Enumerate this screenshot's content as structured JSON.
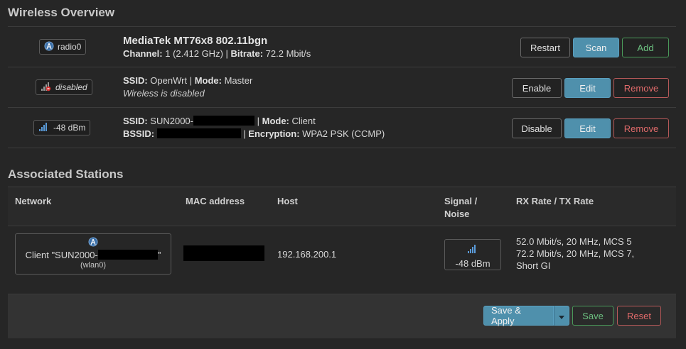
{
  "wireless_overview": {
    "title": "Wireless Overview",
    "radio": {
      "badge": "radio0",
      "name": "MediaTek MT76x8 802.11bgn",
      "channel_label": "Channel:",
      "channel_value": "1 (2.412 GHz)",
      "bitrate_label": "Bitrate:",
      "bitrate_value": "72.2 Mbit/s",
      "buttons": {
        "restart": "Restart",
        "scan": "Scan",
        "add": "Add"
      }
    },
    "networks": [
      {
        "badge": "disabled",
        "ssid_label": "SSID:",
        "ssid": "OpenWrt",
        "mode_label": "Mode:",
        "mode": "Master",
        "note": "Wireless is disabled",
        "buttons": {
          "toggle": "Enable",
          "edit": "Edit",
          "remove": "Remove"
        }
      },
      {
        "badge": "-48 dBm",
        "ssid_label": "SSID:",
        "ssid_prefix": "SUN2000-",
        "mode_label": "Mode:",
        "mode": "Client",
        "bssid_label": "BSSID:",
        "encryption_label": "Encryption:",
        "encryption": "WPA2 PSK (CCMP)",
        "buttons": {
          "toggle": "Disable",
          "edit": "Edit",
          "remove": "Remove"
        }
      }
    ]
  },
  "associated_stations": {
    "title": "Associated Stations",
    "headers": {
      "network": "Network",
      "mac": "MAC address",
      "host": "Host",
      "signal_1": "Signal /",
      "signal_2": "Noise",
      "rate": "RX Rate / TX Rate"
    },
    "rows": [
      {
        "network_prefix": "Client \"SUN2000-",
        "network_suffix": "\"",
        "iface": "(wlan0)",
        "host": "192.168.200.1",
        "signal": "-48 dBm",
        "rx_rate": "52.0 Mbit/s, 20 MHz, MCS 5",
        "tx_rate_1": "72.2 Mbit/s, 20 MHz, MCS 7,",
        "tx_rate_2": "Short GI"
      }
    ]
  },
  "footer": {
    "save_apply": "Save & Apply",
    "save": "Save",
    "reset": "Reset"
  },
  "colors": {
    "primary": "#4f90ac",
    "positive": "#6cc080",
    "negative": "#e06a6a",
    "background": "#262626"
  },
  "icons": {
    "radio": "radio-antenna-icon",
    "disabled": "signal-disabled-icon",
    "signal": "signal-bars-icon",
    "caret": "caret-down-icon"
  }
}
